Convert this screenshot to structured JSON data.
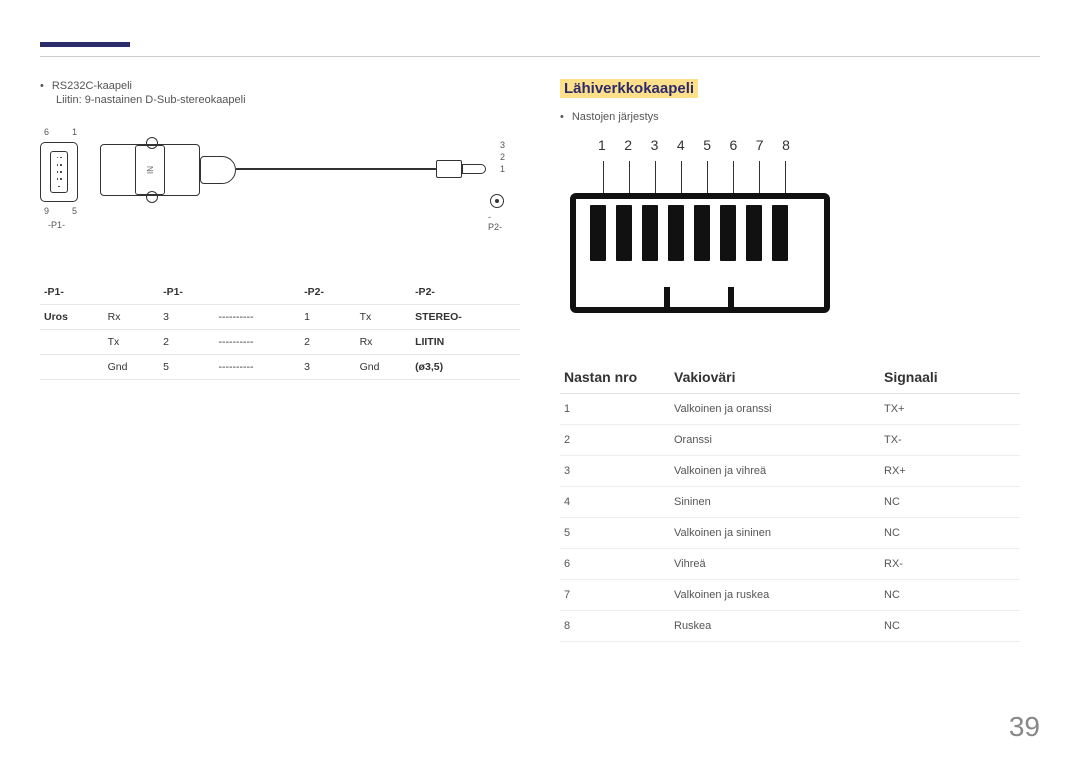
{
  "left": {
    "bullet": "RS232C-kaapeli",
    "subline": "Liitin: 9-nastainen D-Sub-stereokaapeli",
    "diagram": {
      "pin6": "6",
      "pin1": "1",
      "pin9": "9",
      "pin5": "5",
      "p1": "-P1-",
      "p2": "-P2-",
      "in": "IN",
      "tip3": "3",
      "tip2": "2",
      "tip1": "1"
    },
    "table": {
      "headers": [
        "-P1-",
        "",
        "-P1-",
        "",
        "-P2-",
        "",
        "-P2-"
      ],
      "rows": [
        [
          "Uros",
          "Rx",
          "3",
          "----------",
          "1",
          "Tx",
          "STEREO-"
        ],
        [
          "",
          "Tx",
          "2",
          "----------",
          "2",
          "Rx",
          "LIITIN"
        ],
        [
          "",
          "Gnd",
          "5",
          "----------",
          "3",
          "Gnd",
          "(ø3,5)"
        ]
      ]
    }
  },
  "right": {
    "title": "Lähiverkkokaapeli",
    "bullet": "Nastojen järjestys",
    "nums": [
      "1",
      "2",
      "3",
      "4",
      "5",
      "6",
      "7",
      "8"
    ],
    "table": {
      "headers": {
        "pin": "Nastan nro",
        "color": "Vakioväri",
        "signal": "Signaali"
      },
      "rows": [
        {
          "pin": "1",
          "color": "Valkoinen ja oranssi",
          "signal": "TX+"
        },
        {
          "pin": "2",
          "color": "Oranssi",
          "signal": "TX-"
        },
        {
          "pin": "3",
          "color": "Valkoinen ja vihreä",
          "signal": "RX+"
        },
        {
          "pin": "4",
          "color": "Sininen",
          "signal": "NC"
        },
        {
          "pin": "5",
          "color": "Valkoinen ja sininen",
          "signal": "NC"
        },
        {
          "pin": "6",
          "color": "Vihreä",
          "signal": "RX-"
        },
        {
          "pin": "7",
          "color": "Valkoinen ja ruskea",
          "signal": "NC"
        },
        {
          "pin": "8",
          "color": "Ruskea",
          "signal": "NC"
        }
      ]
    }
  },
  "page_number": "39"
}
